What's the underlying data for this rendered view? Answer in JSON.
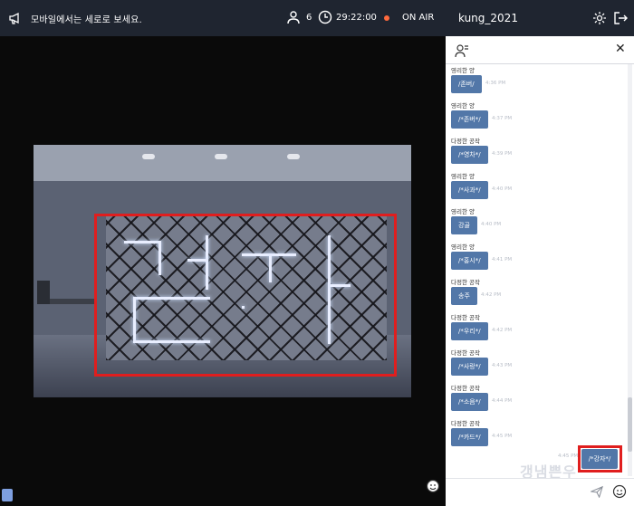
{
  "topbar": {
    "notice": "모바일에서는 세로로 보세요.",
    "viewer_count": "6",
    "time": "29:22:00",
    "on_air": "ON AIR"
  },
  "chat": {
    "room_name": "kung_2021",
    "messages": [
      {
        "sender": "영리한 양",
        "text": "/존버/",
        "time": "4:36 PM"
      },
      {
        "sender": "영리한 양",
        "text": "/*존버*/",
        "time": "4:37 PM"
      },
      {
        "sender": "다정한 공작",
        "text": "/*영차*/",
        "time": "4:39 PM"
      },
      {
        "sender": "영리한 양",
        "text": "/*사과*/",
        "time": "4:40 PM"
      },
      {
        "sender": "영리한 양",
        "text": "강골",
        "time": "4:40 PM"
      },
      {
        "sender": "영리한 양",
        "text": "/*홍시*/",
        "time": "4:41 PM"
      },
      {
        "sender": "다정한 공작",
        "text": "송주",
        "time": "4:42 PM"
      },
      {
        "sender": "다정한 공작",
        "text": "/*우리*/",
        "time": "4:42 PM"
      },
      {
        "sender": "다정한 공작",
        "text": "/*사랑*/",
        "time": "4:43 PM"
      },
      {
        "sender": "다정한 공작",
        "text": "/*소음*/",
        "time": "4:44 PM"
      },
      {
        "sender": "다정한 공작",
        "text": "/*카드*/",
        "time": "4:45 PM"
      }
    ],
    "my_message": {
      "text": "/*강자*/",
      "time": "4:45 PM"
    },
    "input_placeholder": "",
    "watermark": "갱냄쁜우"
  },
  "colors": {
    "accent": "#5277a8",
    "header": "#1f2530",
    "highlight": "#e01e1e",
    "on_air_dot": "#ff6a3d"
  },
  "icons": [
    "megaphone-icon",
    "user-icon",
    "clock-icon",
    "gear-icon",
    "exit-icon",
    "people-icon",
    "close-icon",
    "send-icon",
    "emoji-icon"
  ]
}
